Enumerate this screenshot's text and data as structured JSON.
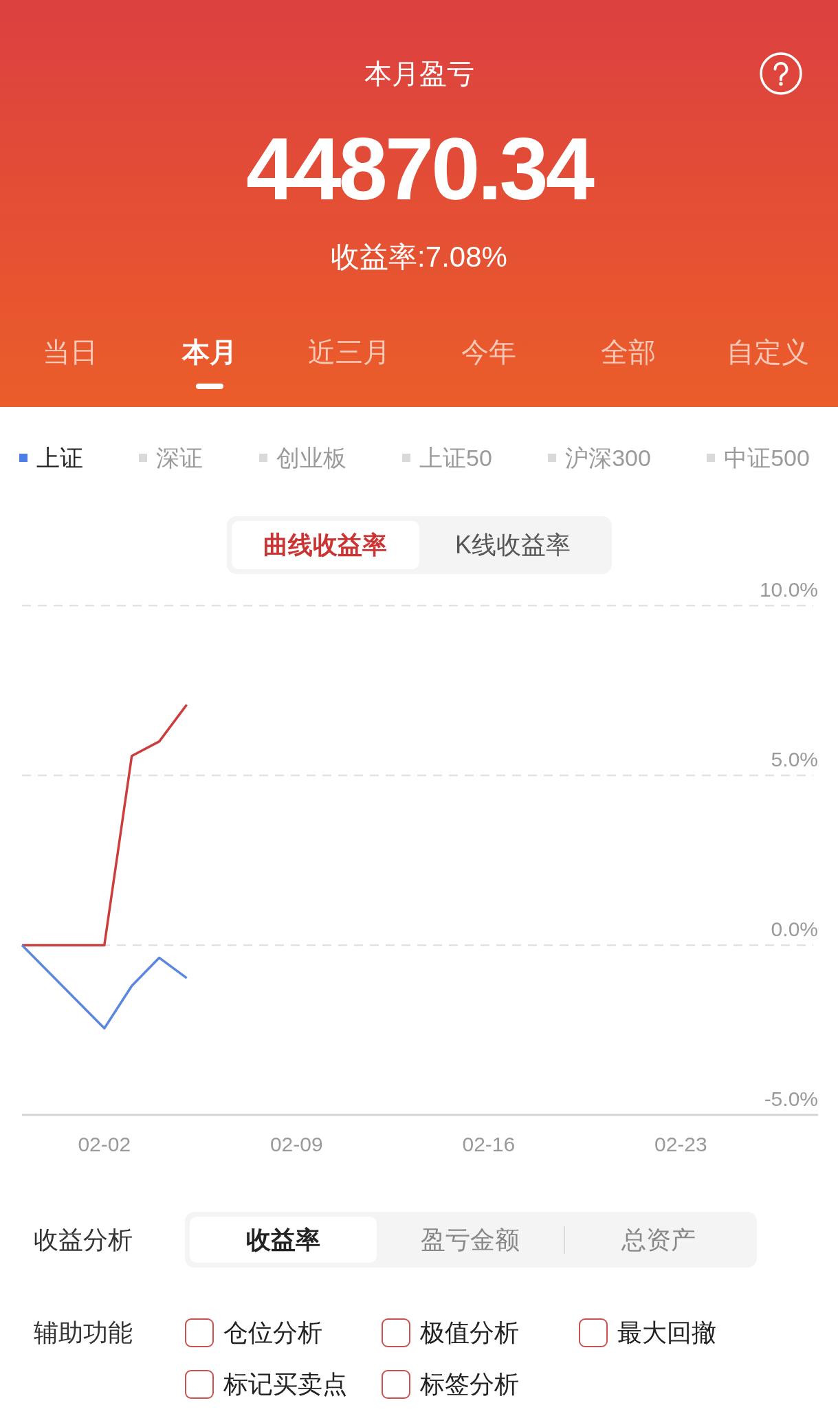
{
  "header": {
    "title": "本月盈亏",
    "amount": "44870.34",
    "return_rate": "收益率:7.08%"
  },
  "tabs": [
    {
      "label": "当日",
      "selected": false
    },
    {
      "label": "本月",
      "selected": true
    },
    {
      "label": "近三月",
      "selected": false
    },
    {
      "label": "今年",
      "selected": false
    },
    {
      "label": "全部",
      "selected": false
    },
    {
      "label": "自定义",
      "selected": false
    }
  ],
  "legend": [
    {
      "label": "上证",
      "selected": true
    },
    {
      "label": "深证",
      "selected": false
    },
    {
      "label": "创业板",
      "selected": false
    },
    {
      "label": "上证50",
      "selected": false
    },
    {
      "label": "沪深300",
      "selected": false
    },
    {
      "label": "中证500",
      "selected": false
    }
  ],
  "chart_mode": [
    {
      "label": "曲线收益率",
      "selected": true
    },
    {
      "label": "K线收益率",
      "selected": false
    }
  ],
  "chart": {
    "chart_data": {
      "type": "line",
      "categories": [
        null,
        null,
        null,
        "02-02",
        null,
        null,
        null,
        null,
        null,
        null,
        "02-09",
        null,
        null,
        null,
        null,
        null,
        null,
        "02-16",
        null,
        null,
        null,
        null,
        null,
        null,
        "02-23",
        null,
        null,
        null,
        null,
        null
      ],
      "series": [
        {
          "color": "#cc3d3d",
          "values": [
            0,
            null,
            null,
            0,
            5.57,
            6.0,
            7.08,
            null,
            null,
            null,
            null,
            null,
            null,
            null,
            null,
            null,
            null,
            null,
            null,
            null,
            null,
            null,
            null,
            null,
            null,
            null,
            null,
            null,
            null,
            null
          ]
        },
        {
          "color": "#5b88de",
          "values": [
            0,
            null,
            null,
            -2.45,
            -1.2,
            -0.37,
            -0.97,
            null,
            null,
            null,
            null,
            null,
            null,
            null,
            null,
            null,
            null,
            null,
            null,
            null,
            null,
            null,
            null,
            null,
            null,
            null,
            null,
            null,
            null,
            null
          ]
        }
      ],
      "ylim": [
        -5,
        10
      ],
      "yticks": [
        {
          "value": -5,
          "label": "-5.0%"
        },
        {
          "value": 0,
          "label": "0.0%"
        },
        {
          "value": 5,
          "label": "5.0%"
        },
        {
          "value": 10,
          "label": "10.0%"
        }
      ]
    }
  },
  "analysis": {
    "label": "收益分析",
    "options": [
      {
        "label": "收益率",
        "selected": true
      },
      {
        "label": "盈亏金额",
        "selected": false
      },
      {
        "label": "总资产",
        "selected": false
      }
    ]
  },
  "tools": {
    "label": "辅助功能",
    "items": [
      {
        "label": "仓位分析",
        "checked": false
      },
      {
        "label": "极值分析",
        "checked": false
      },
      {
        "label": "最大回撤",
        "checked": false
      },
      {
        "label": "标记买卖点",
        "checked": false
      },
      {
        "label": "标签分析",
        "checked": false
      }
    ]
  }
}
